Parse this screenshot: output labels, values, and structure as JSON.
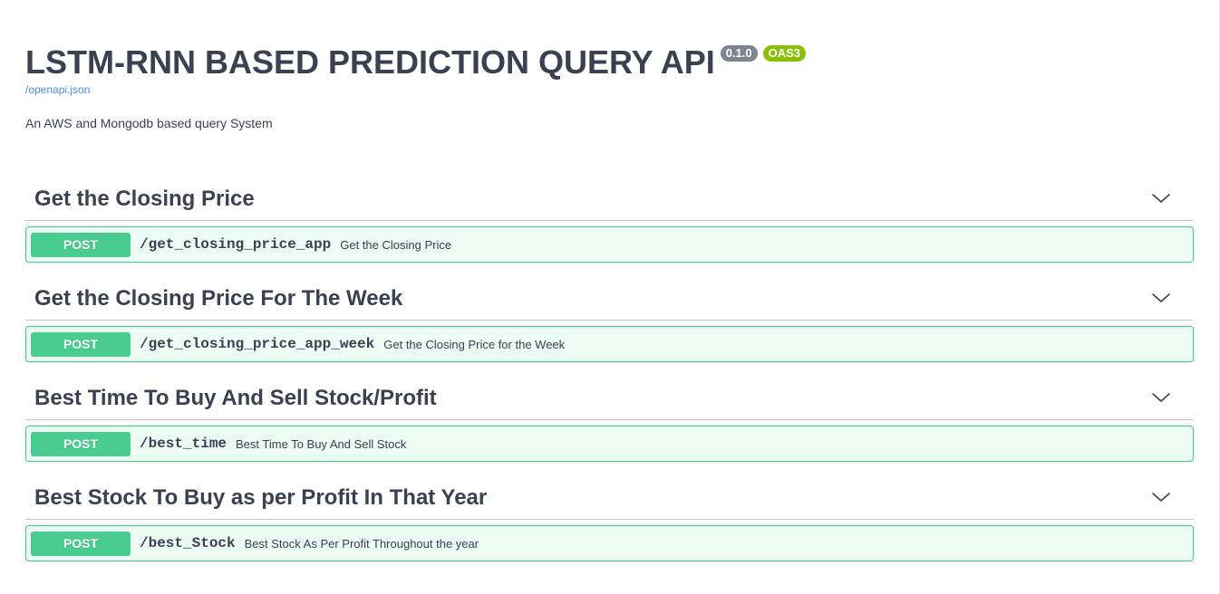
{
  "info": {
    "title": "LSTM-RNN BASED PREDICTION QUERY API",
    "version": "0.1.0",
    "oas_badge": "OAS3",
    "spec_link": "/openapi.json",
    "description": "An AWS and Mongodb based query System"
  },
  "colors": {
    "post_method": "#49cc90",
    "version_badge": "#7d8492",
    "oas_badge": "#89bf04",
    "link": "#4990e2",
    "text": "#3b4151"
  },
  "tags": [
    {
      "name": "Get the Closing Price",
      "icon": "chevron-down-icon",
      "operation": {
        "method": "POST",
        "path": "/get_closing_price_app",
        "summary": "Get the Closing Price"
      }
    },
    {
      "name": "Get the Closing Price For The Week",
      "icon": "chevron-down-icon",
      "operation": {
        "method": "POST",
        "path": "/get_closing_price_app_week",
        "summary": "Get the Closing Price for the Week"
      }
    },
    {
      "name": "Best Time To Buy And Sell Stock/Profit",
      "icon": "chevron-down-icon",
      "operation": {
        "method": "POST",
        "path": "/best_time",
        "summary": "Best Time To Buy And Sell Stock"
      }
    },
    {
      "name": "Best Stock To Buy as per Profit In That Year",
      "icon": "chevron-down-icon",
      "operation": {
        "method": "POST",
        "path": "/best_Stock",
        "summary": "Best Stock As Per Profit Throughout the year"
      }
    }
  ]
}
